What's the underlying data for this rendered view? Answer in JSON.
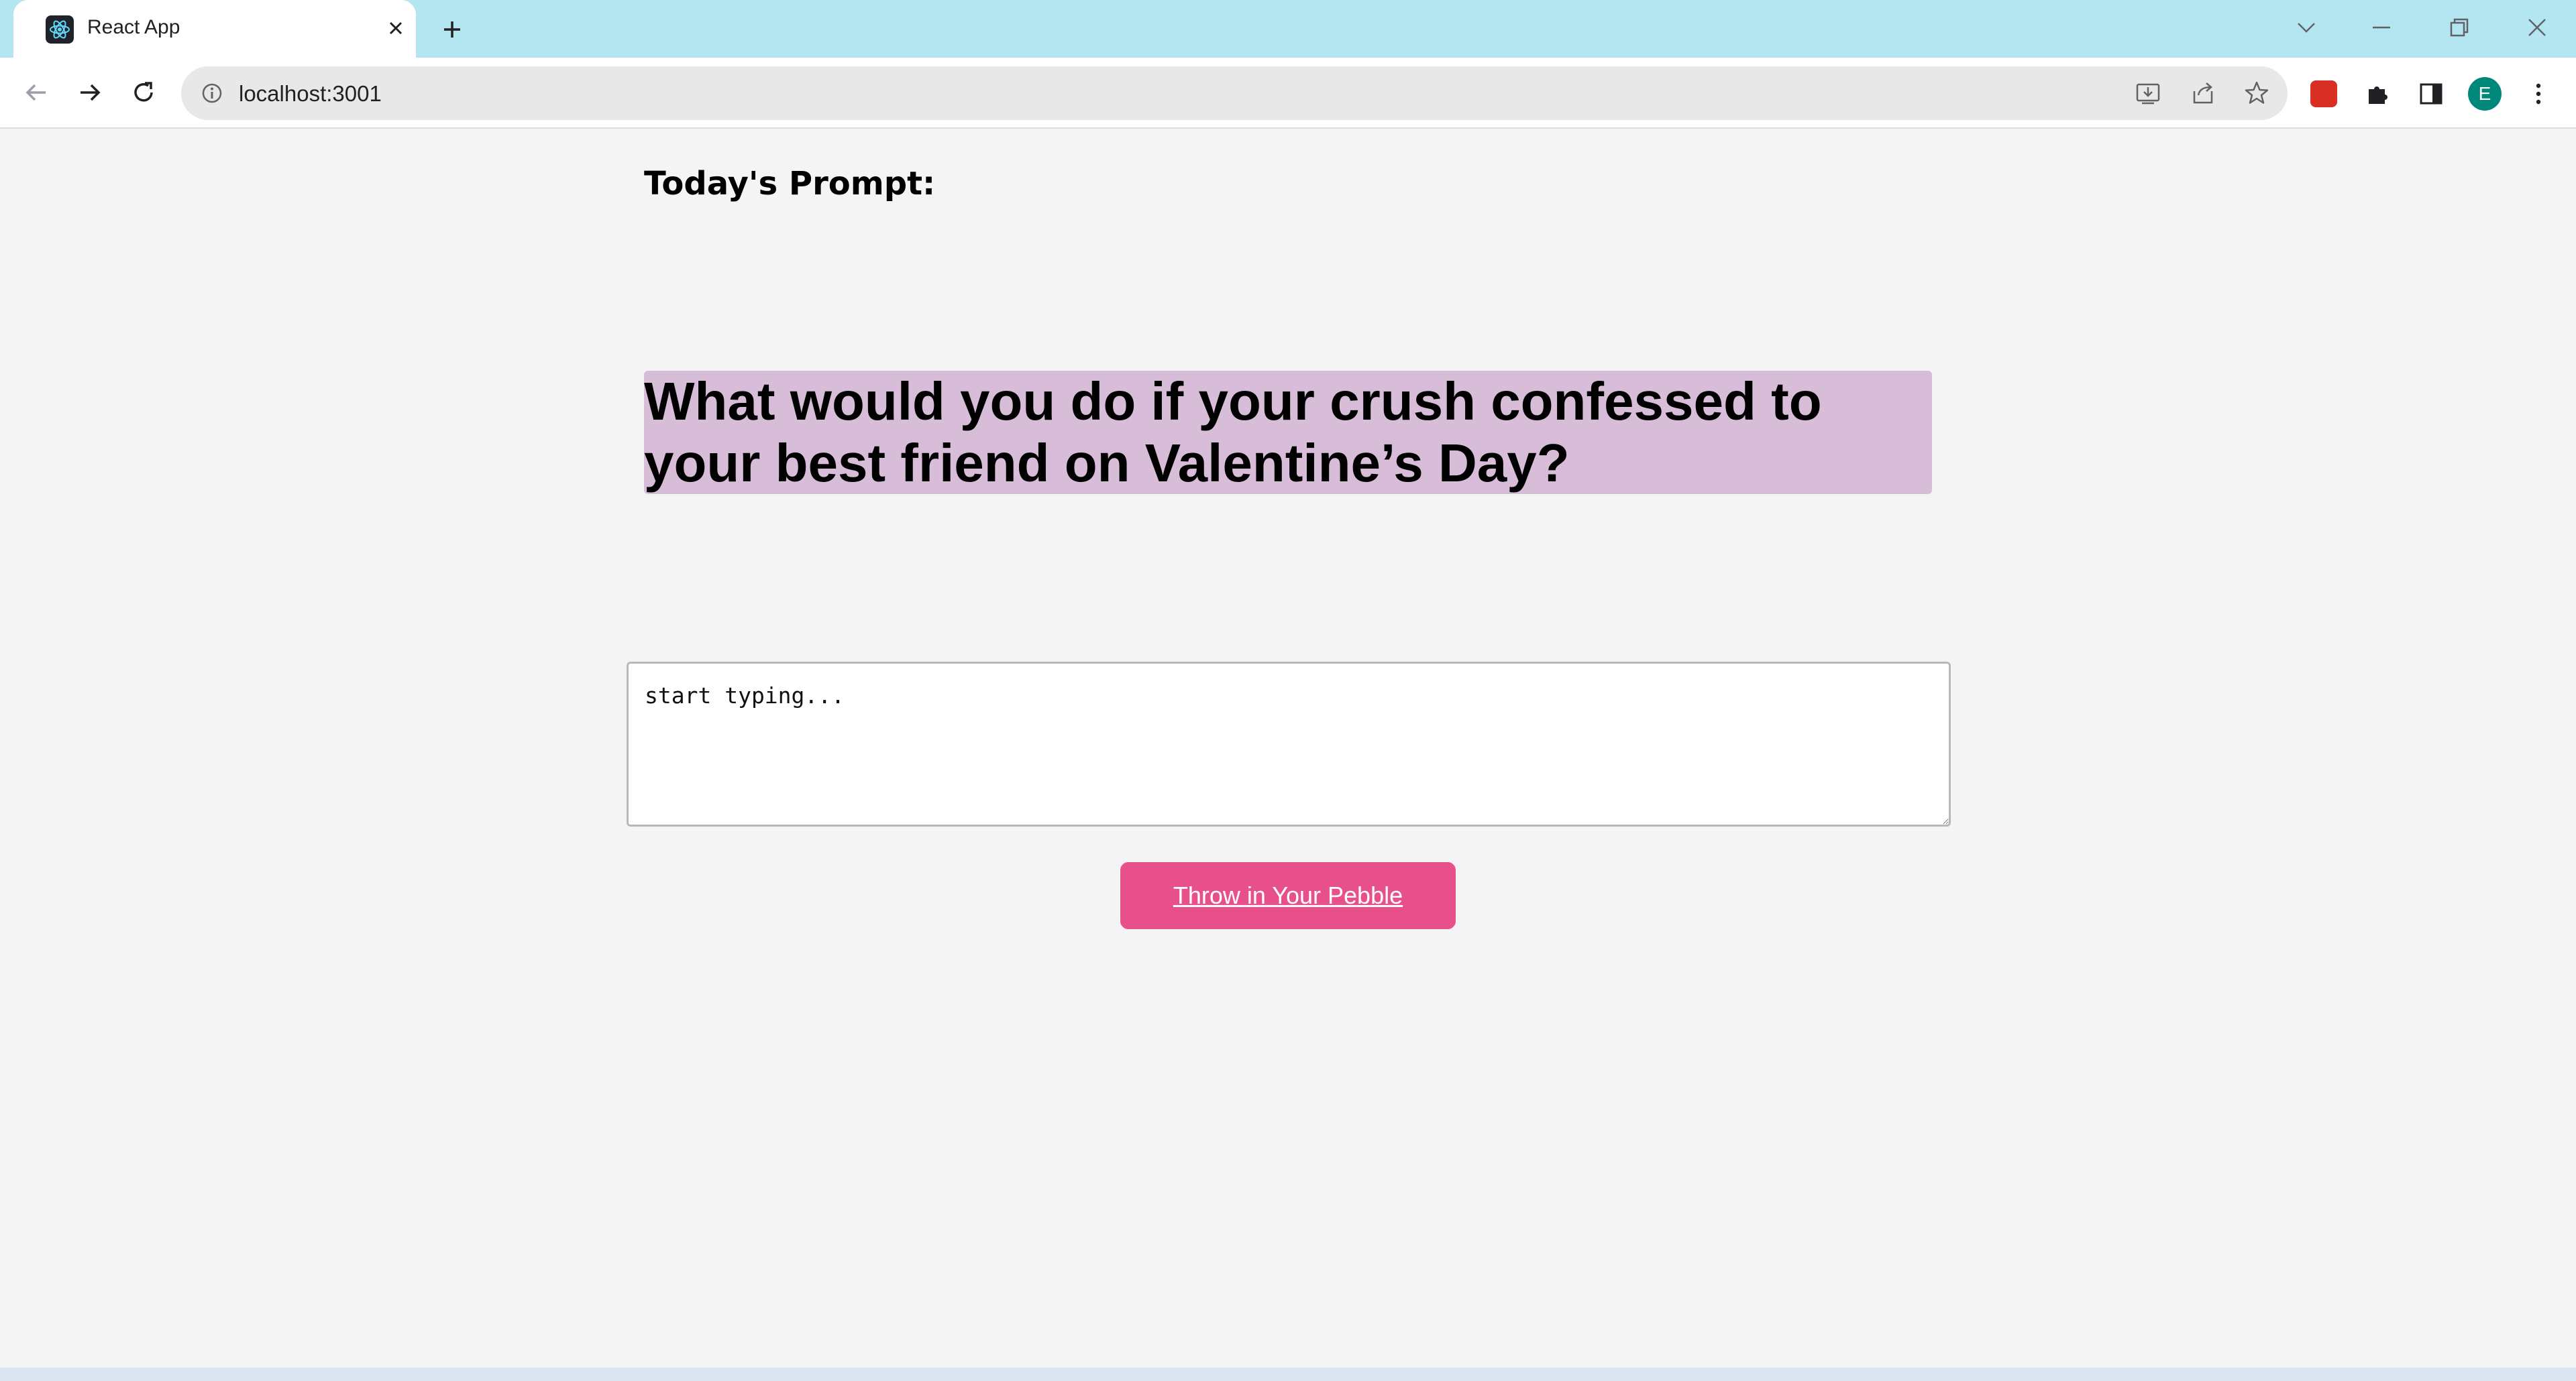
{
  "browser": {
    "tab": {
      "title": "React App",
      "close_icon": "close-icon"
    },
    "new_tab_icon": "plus-icon",
    "address": {
      "url": "localhost:3001"
    },
    "profile_initial": "E"
  },
  "page": {
    "heading": "Today's Prompt:",
    "prompt": "What would you do if your crush confessed to your best friend on Valentine’s Day?",
    "entry": {
      "placeholder": "start typing...",
      "value": ""
    },
    "submit_label": "Throw in Your Pebble"
  },
  "colors": {
    "tabstrip": "#b3e6f0",
    "prompt_highlight": "#d8bdd8",
    "button": "#e8508b",
    "avatar": "#00897b",
    "page_background": "#f4f4f4"
  }
}
